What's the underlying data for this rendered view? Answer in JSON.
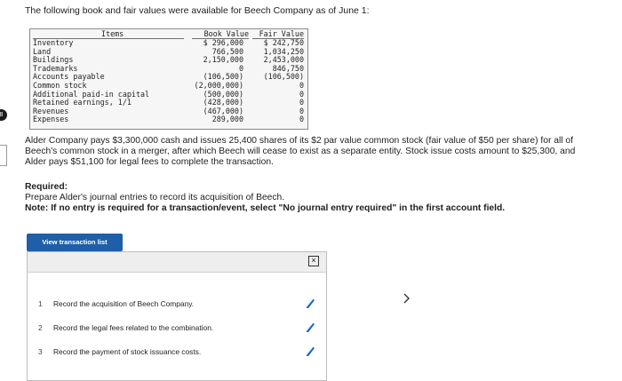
{
  "intro": "The following book and fair values were available for Beech Company as of June 1:",
  "left_marker": "8",
  "table": {
    "headers": {
      "items": "Items",
      "book": "Book Value",
      "fair": "Fair Value"
    },
    "rows": [
      {
        "item": "Inventory",
        "book": "$ 296,000",
        "fair": "$ 242,750"
      },
      {
        "item": "Land",
        "book": "766,500",
        "fair": "1,034,250"
      },
      {
        "item": "Buildings",
        "book": "2,150,000",
        "fair": "2,453,000"
      },
      {
        "item": "Trademarks",
        "book": "0",
        "fair": "846,750"
      },
      {
        "item": "Accounts payable",
        "book": "(106,500)",
        "fair": "(106,500)"
      },
      {
        "item": "Common stock",
        "book": "(2,000,000)",
        "fair": "0"
      },
      {
        "item": "Additional paid-in capital",
        "book": "(500,000)",
        "fair": "0"
      },
      {
        "item": "Retained earnings, 1/1",
        "book": "(428,000)",
        "fair": "0"
      },
      {
        "item": "Revenues",
        "book": "(467,000)",
        "fair": "0"
      },
      {
        "item": "Expenses",
        "book": "289,000",
        "fair": "0"
      }
    ]
  },
  "paragraph": "Alder Company pays $3,300,000 cash and issues 25,400 shares of its $2 par value common stock (fair value of $50 per share) for all of Beech's common stock in a merger, after which Beech will cease to exist as a separate entity. Stock issue costs amount to $25,300, and Alder pays $51,100 for legal fees to complete the transaction.",
  "required": {
    "title": "Required:",
    "text": "Prepare Alder's journal entries to record its acquisition of Beech.",
    "note_label": "Note:",
    "note_text": "If no entry is required for a transaction/event, select \"No journal entry required\" in the first account field."
  },
  "view_button": "View transaction list",
  "close_icon": "×",
  "transactions": [
    {
      "num": "1",
      "desc": "Record the acquisition of Beech Company."
    },
    {
      "num": "2",
      "desc": "Record the legal fees related to the combination."
    },
    {
      "num": "3",
      "desc": "Record the payment of stock issuance costs."
    }
  ],
  "colors": {
    "accent": "#1f5ea8",
    "pencil": "#1a63c6"
  },
  "icons": {
    "edit": "pencil-icon",
    "next": "chevron-right-icon",
    "close": "close-icon"
  }
}
